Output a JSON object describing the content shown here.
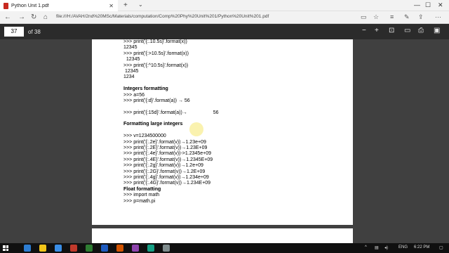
{
  "browser": {
    "tab_title": "Python Unit 1.pdf",
    "url": "file:///H:/AVAH/2nd%20MSc/Materials/computation/Comp%20Phy%20Unit%201/Python%20Unit%201.pdf"
  },
  "pdf_toolbar": {
    "page_number": "37",
    "page_total": "of 38"
  },
  "document": {
    "lines": [
      {
        "text": ">>> print('{:.10.5s}'.format(x))",
        "kind": "code"
      },
      {
        "text": "12345",
        "kind": "code"
      },
      {
        "text": ">>> print('{:>10.5s}'.format(x))",
        "kind": "code"
      },
      {
        "text": "  12345",
        "kind": "code"
      },
      {
        "text": ">>> print('{:^10.5s}'.format(x))",
        "kind": "code"
      },
      {
        "text": " 12345",
        "kind": "code"
      },
      {
        "text": "1234",
        "kind": "code"
      },
      {
        "text": "",
        "kind": "gap"
      },
      {
        "text": "Integers formatting",
        "kind": "heading"
      },
      {
        "text": ">>> a=56",
        "kind": "code"
      },
      {
        "text": ">>> print('{:d}'.format(a)) → 56",
        "kind": "code"
      },
      {
        "text": "",
        "kind": "gap"
      },
      {
        "text": ">>> print('{:15d}'.format(a))→                   56",
        "kind": "code"
      },
      {
        "text": "",
        "kind": "gap"
      },
      {
        "text": "Formatting large integers",
        "kind": "heading"
      },
      {
        "text": "",
        "kind": "gap"
      },
      {
        "text": ">>> v=1234500000",
        "kind": "code"
      },
      {
        "text": ">>> print('{:.2e}'.format(v))→1.23e+09",
        "kind": "code"
      },
      {
        "text": ">>> print('{:.2E}'.format(v))→1.23E+09",
        "kind": "code"
      },
      {
        "text": ">>> print('{:.4e}'.format(v))->1.2345e+09",
        "kind": "code"
      },
      {
        "text": ">>> print('{:.4E}'.format(v))→1.2345E+09",
        "kind": "code"
      },
      {
        "text": ">>> print('{:.2g}'.format(v))→1.2e+09",
        "kind": "code"
      },
      {
        "text": ">>> print('{:.2G}'.format(v))→1.2E+09",
        "kind": "code"
      },
      {
        "text": ">>> print('{:.4g}'.format(v))→1.234e+09",
        "kind": "code"
      },
      {
        "text": ">>> print('{:.4G}'.format(v))→1.234E+09",
        "kind": "code"
      },
      {
        "text": "Float formatting",
        "kind": "heading"
      },
      {
        "text": ">>> import math",
        "kind": "code"
      },
      {
        "text": ">>> p=math.pi",
        "kind": "code"
      }
    ]
  },
  "taskbar": {
    "language": "ENG",
    "time": "6:22 PM"
  },
  "colors": {
    "pdf_toolbar_bg": "#2b2b2b",
    "document_bg": "#404040",
    "highlight": "#f3e87c",
    "taskbar_bg": "#101010"
  }
}
